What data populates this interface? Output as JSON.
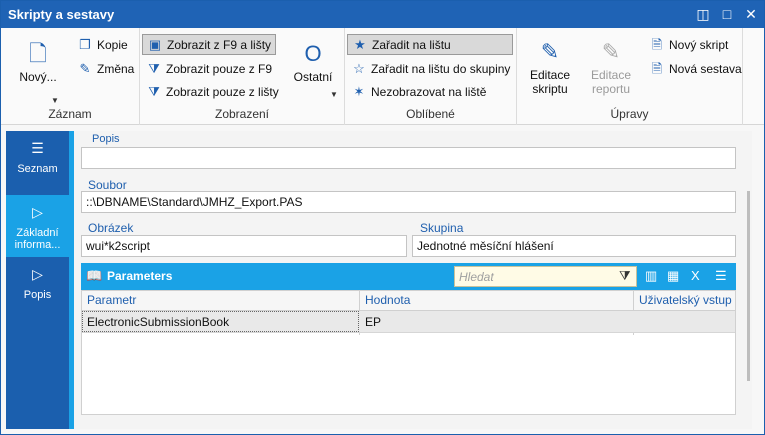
{
  "window": {
    "title": "Skripty a sestavy"
  },
  "ribbon": {
    "zaznam": {
      "name": "Záznam",
      "novy": "Nový...",
      "kopie": "Kopie",
      "zmena": "Změna"
    },
    "zobrazeni": {
      "name": "Zobrazení",
      "z_f9_lista": "Zobrazit z F9 a lišty",
      "pouze_f9": "Zobrazit pouze z F9",
      "pouze_lista": "Zobrazit pouze z lišty",
      "ostatni": "Ostatní"
    },
    "oblibene": {
      "name": "Oblíbené",
      "zaradit": "Zařadit na lištu",
      "zaradit_skupina": "Zařadit na lištu do skupiny",
      "nezobrazovat": "Nezobrazovat na liště"
    },
    "upravy": {
      "name": "Úpravy",
      "editace_skriptu": [
        "Editace",
        "skriptu"
      ],
      "editace_reportu": [
        "Editace",
        "reportu"
      ],
      "novy_skript": "Nový skript",
      "nova_sestava": "Nová sestava"
    }
  },
  "sidebar": {
    "items": [
      {
        "label": "Seznam"
      },
      {
        "label": "Základní informa..."
      },
      {
        "label": "Popis"
      }
    ]
  },
  "form": {
    "popis_label": "Popis",
    "popis_value": "",
    "soubor_label": "Soubor",
    "soubor_value": "::\\DBNAME\\Standard\\JMHZ_Export.PAS",
    "obrazek_label": "Obrázek",
    "obrazek_value": "wui*k2script",
    "skupina_label": "Skupina",
    "skupina_value": "Jednotné měsíční hlášení"
  },
  "parameters": {
    "title": "Parameters",
    "search_placeholder": "Hledat",
    "columns": [
      "Parametr",
      "Hodnota",
      "Uživatelský vstup"
    ],
    "rows": [
      {
        "parametr": "ElectronicSubmissionBook",
        "hodnota": "EP",
        "vstup": ""
      }
    ]
  }
}
